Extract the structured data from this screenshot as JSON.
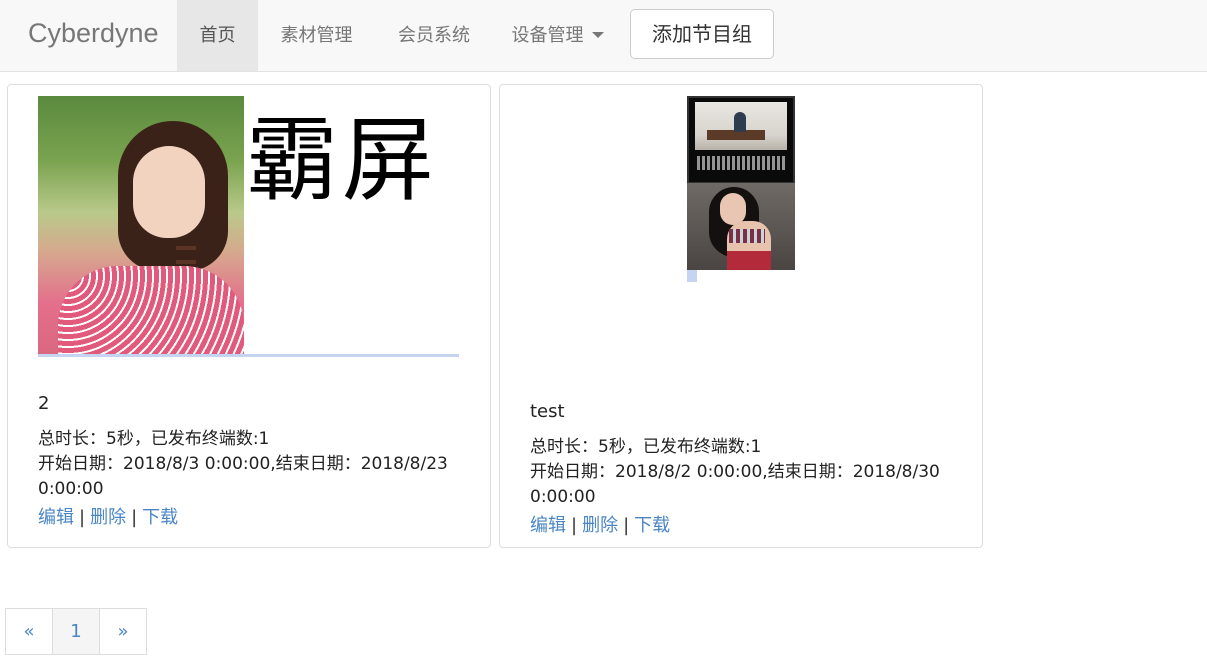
{
  "navbar": {
    "brand": "Cyberdyne",
    "items": [
      {
        "label": "首页",
        "active": true
      },
      {
        "label": "素材管理",
        "active": false
      },
      {
        "label": "会员系统",
        "active": false
      },
      {
        "label": "设备管理",
        "active": false,
        "dropdown": true
      }
    ],
    "add_button": "添加节目组"
  },
  "cards": [
    {
      "preview_text": "霸屏",
      "title": "2",
      "summary": "总时长：5秒，已发布终端数:1",
      "dates": "开始日期：2018/8/3 0:00:00,结束日期：2018/8/23 0:00:00",
      "links": {
        "edit": "编辑",
        "delete": "删除",
        "download": "下载"
      },
      "separator": "|"
    },
    {
      "title": "test",
      "summary": "总时长：5秒，已发布终端数:1",
      "dates": "开始日期：2018/8/2 0:00:00,结束日期：2018/8/30 0:00:00",
      "links": {
        "edit": "编辑",
        "delete": "删除",
        "download": "下载"
      },
      "separator": "|"
    }
  ],
  "pagination": {
    "prev": "«",
    "current": "1",
    "next": "»"
  },
  "colors": {
    "link": "#4a86c5",
    "navbar_bg": "#f8f8f8",
    "active_nav_bg": "#e7e7e7"
  }
}
